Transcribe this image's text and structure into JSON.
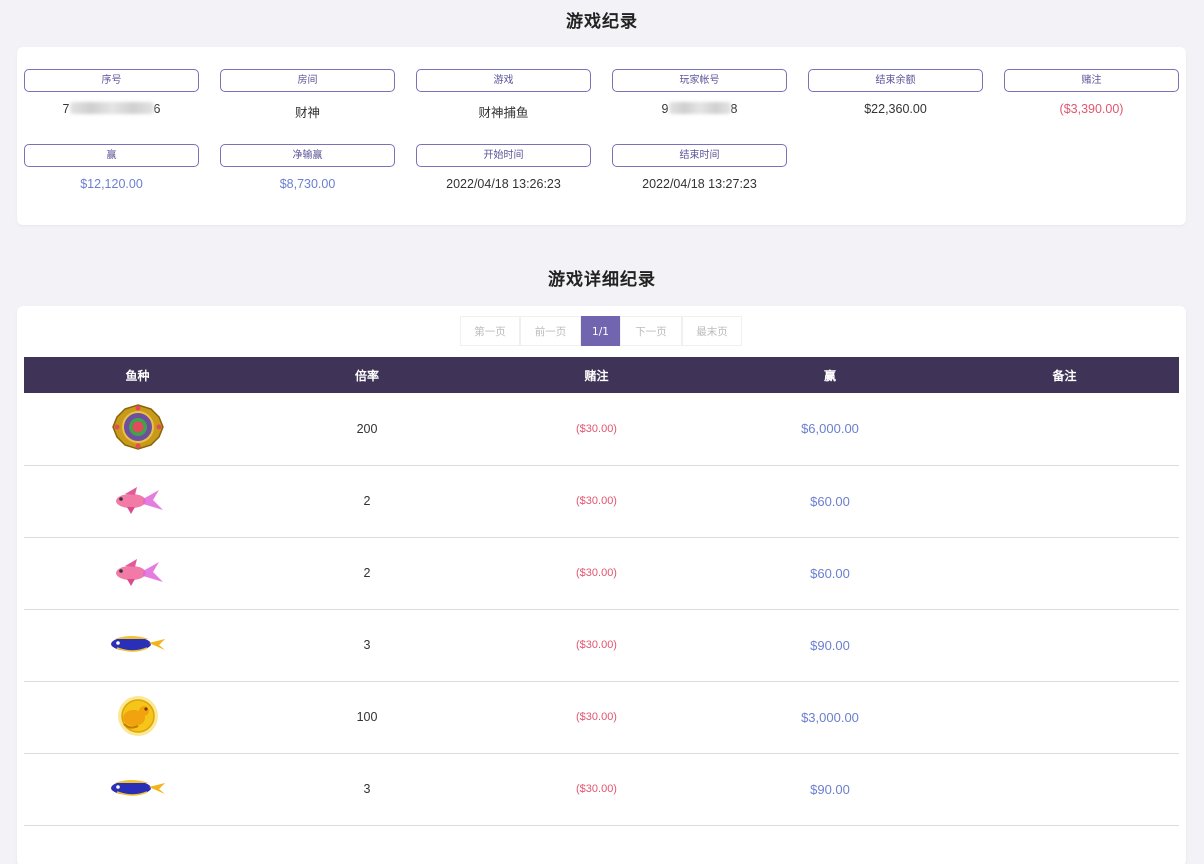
{
  "summary": {
    "title": "游戏纪录",
    "fields": [
      {
        "label": "序号",
        "value_prefix": "7",
        "value_suffix": "6"
      },
      {
        "label": "房间",
        "value": "财神"
      },
      {
        "label": "游戏",
        "value": "财神捕鱼"
      },
      {
        "label": "玩家帐号",
        "value_prefix": "9",
        "value_suffix": "8"
      },
      {
        "label": "结束余额",
        "value": "$22,360.00"
      },
      {
        "label": "赌注",
        "value": "($3,390.00)"
      },
      {
        "label": "赢",
        "value": "$12,120.00"
      },
      {
        "label": "净输赢",
        "value": "$8,730.00"
      },
      {
        "label": "开始时间",
        "value": "2022/04/18 13:26:23"
      },
      {
        "label": "结束时间",
        "value": "2022/04/18 13:27:23"
      }
    ]
  },
  "detail": {
    "title": "游戏详细纪录",
    "pager": {
      "first": "第一页",
      "prev": "前一页",
      "current": "1/1",
      "next": "下一页",
      "last": "最末页"
    },
    "columns": [
      "鱼种",
      "倍率",
      "赌注",
      "赢",
      "备注"
    ],
    "rows": [
      {
        "fish": "golden-medallion-icon",
        "multiplier": "200",
        "bet": "($30.00)",
        "win": "$6,000.00",
        "note": ""
      },
      {
        "fish": "pink-fish-icon",
        "multiplier": "2",
        "bet": "($30.00)",
        "win": "$60.00",
        "note": ""
      },
      {
        "fish": "pink-fish-icon",
        "multiplier": "2",
        "bet": "($30.00)",
        "win": "$60.00",
        "note": ""
      },
      {
        "fish": "blue-fish-icon",
        "multiplier": "3",
        "bet": "($30.00)",
        "win": "$90.00",
        "note": ""
      },
      {
        "fish": "golden-toad-icon",
        "multiplier": "100",
        "bet": "($30.00)",
        "win": "$3,000.00",
        "note": ""
      },
      {
        "fish": "blue-fish-icon",
        "multiplier": "3",
        "bet": "($30.00)",
        "win": "$90.00",
        "note": ""
      }
    ]
  },
  "colors": {
    "accent": "#7165b0",
    "header_bg": "#3f3357",
    "negative": "#e0566e",
    "positive": "#6b7fd0"
  }
}
